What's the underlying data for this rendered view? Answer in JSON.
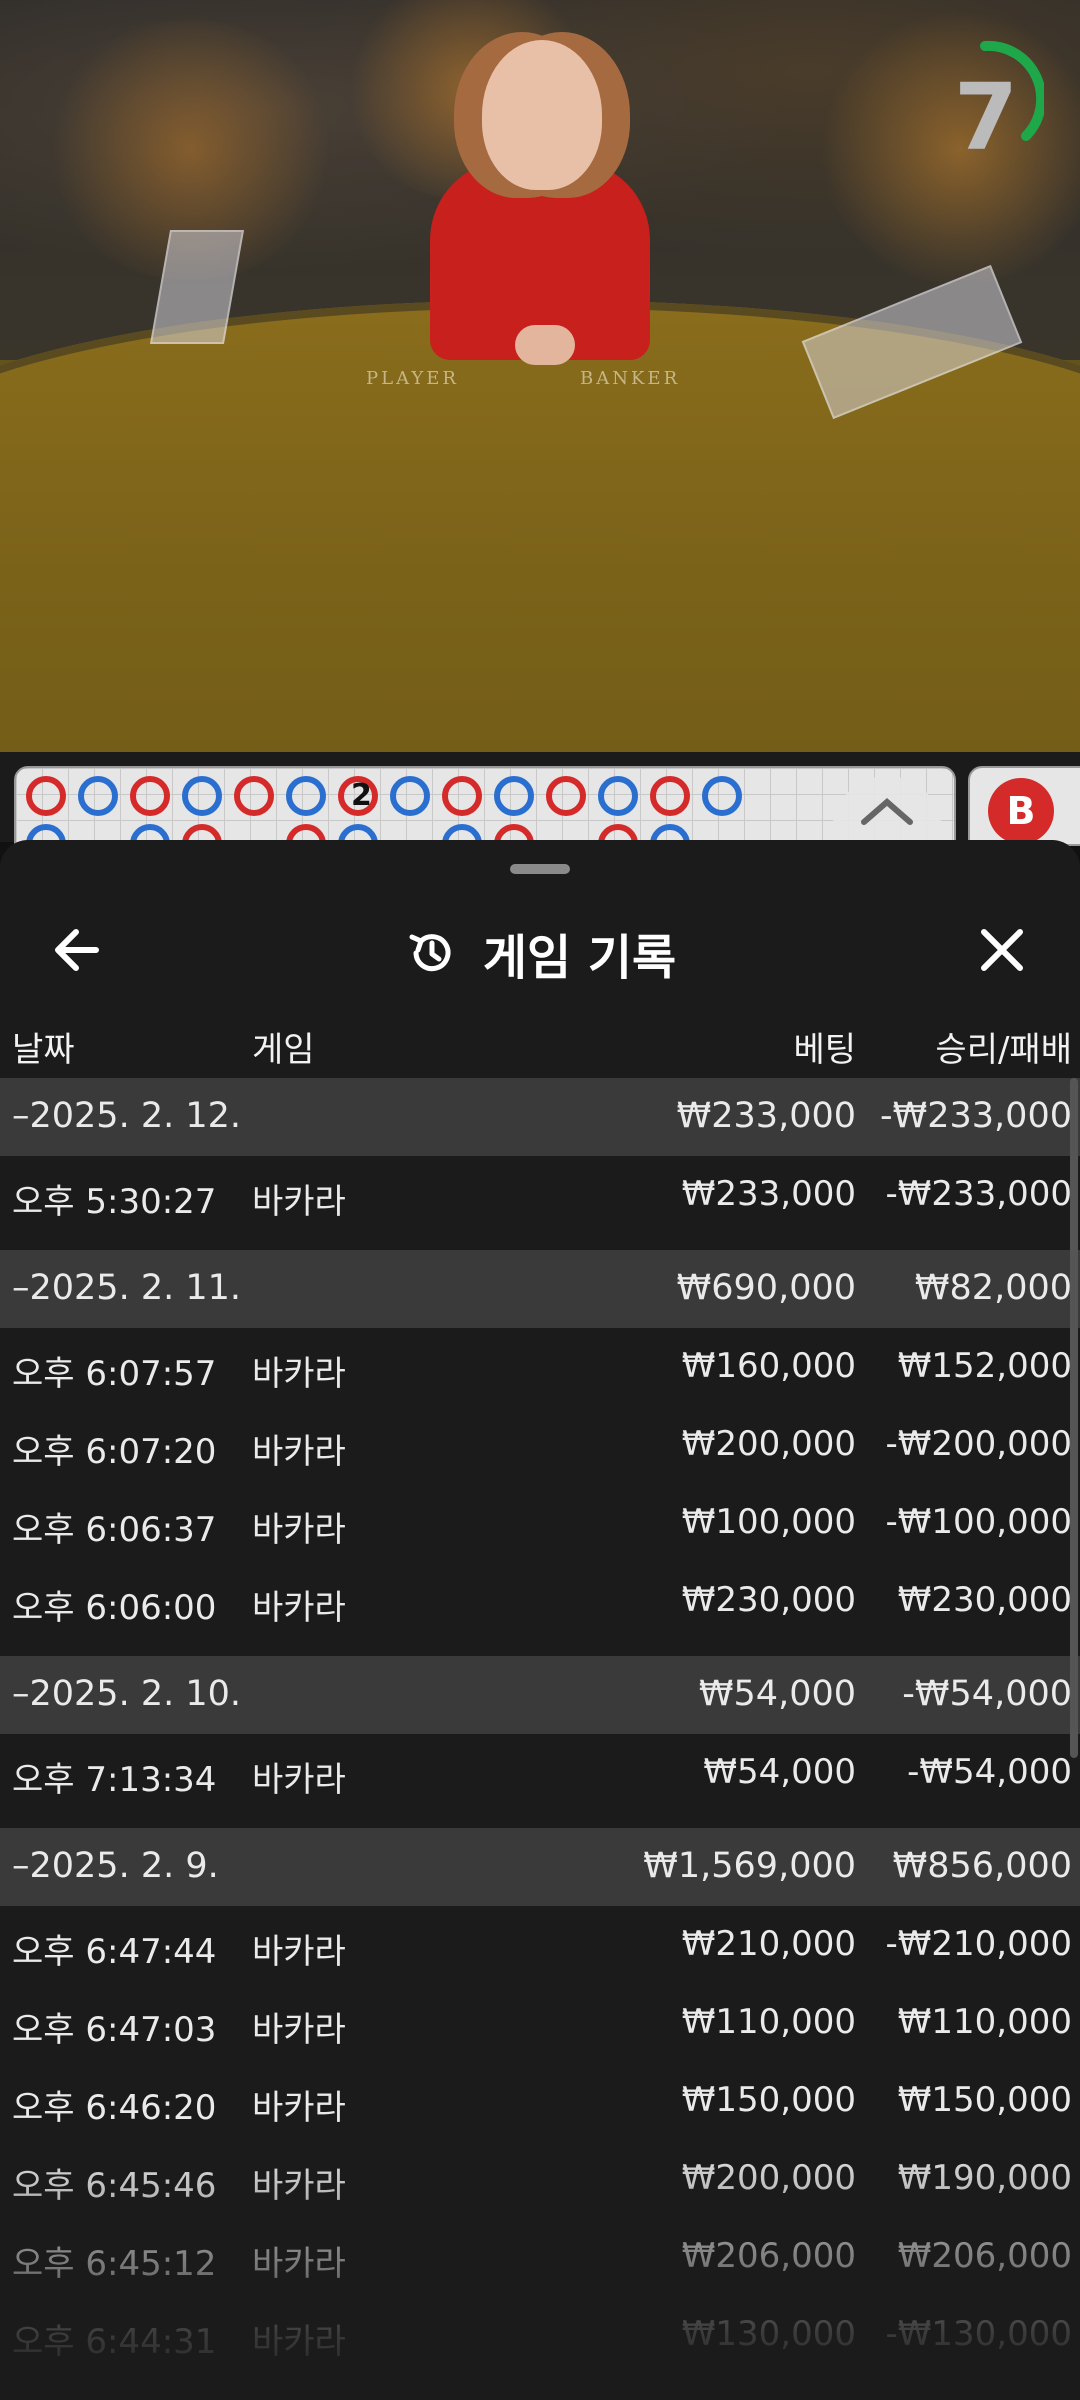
{
  "video": {
    "timer_value": "7",
    "table_labels": {
      "player": "PLAYER",
      "banker": "BANKER"
    }
  },
  "roadmap": {
    "beads": [
      "r",
      "b",
      "r",
      "b",
      "r",
      "b",
      "r",
      "b",
      "r",
      "b",
      "r",
      "b",
      "r",
      "b"
    ],
    "marked_bead_label": "2",
    "banker_button_label": "B"
  },
  "sheet": {
    "title": "게임 기록",
    "icons": {
      "back": "arrow-left-icon",
      "history": "history-icon",
      "close": "close-icon"
    },
    "columns": {
      "date": "날짜",
      "game": "게임",
      "bet": "베팅",
      "win_loss": "승리/패배"
    },
    "rows": [
      {
        "type": "group",
        "date": "–2025. 2. 12.",
        "bet": "₩233,000",
        "win": "-₩233,000"
      },
      {
        "type": "item",
        "time": "오후 5:30:27",
        "game": "바카라",
        "bet": "₩233,000",
        "win": "-₩233,000"
      },
      {
        "type": "group",
        "date": "–2025. 2. 11.",
        "bet": "₩690,000",
        "win": "₩82,000"
      },
      {
        "type": "item",
        "time": "오후 6:07:57",
        "game": "바카라",
        "bet": "₩160,000",
        "win": "₩152,000"
      },
      {
        "type": "item",
        "time": "오후 6:07:20",
        "game": "바카라",
        "bet": "₩200,000",
        "win": "-₩200,000"
      },
      {
        "type": "item",
        "time": "오후 6:06:37",
        "game": "바카라",
        "bet": "₩100,000",
        "win": "-₩100,000"
      },
      {
        "type": "item",
        "time": "오후 6:06:00",
        "game": "바카라",
        "bet": "₩230,000",
        "win": "₩230,000"
      },
      {
        "type": "group",
        "date": "–2025. 2. 10.",
        "bet": "₩54,000",
        "win": "-₩54,000"
      },
      {
        "type": "item",
        "time": "오후 7:13:34",
        "game": "바카라",
        "bet": "₩54,000",
        "win": "-₩54,000"
      },
      {
        "type": "group",
        "date": "–2025. 2. 9.",
        "bet": "₩1,569,000",
        "win": "₩856,000"
      },
      {
        "type": "item",
        "time": "오후 6:47:44",
        "game": "바카라",
        "bet": "₩210,000",
        "win": "-₩210,000"
      },
      {
        "type": "item",
        "time": "오후 6:47:03",
        "game": "바카라",
        "bet": "₩110,000",
        "win": "₩110,000"
      },
      {
        "type": "item",
        "time": "오후 6:46:20",
        "game": "바카라",
        "bet": "₩150,000",
        "win": "₩150,000"
      },
      {
        "type": "item",
        "time": "오후 6:45:46",
        "game": "바카라",
        "bet": "₩200,000",
        "win": "₩190,000"
      },
      {
        "type": "item",
        "time": "오후 6:45:12",
        "game": "바카라",
        "bet": "₩206,000",
        "win": "₩206,000"
      },
      {
        "type": "item",
        "time": "오후 6:44:31",
        "game": "바카라",
        "bet": "₩130,000",
        "win": "-₩130,000"
      }
    ]
  }
}
